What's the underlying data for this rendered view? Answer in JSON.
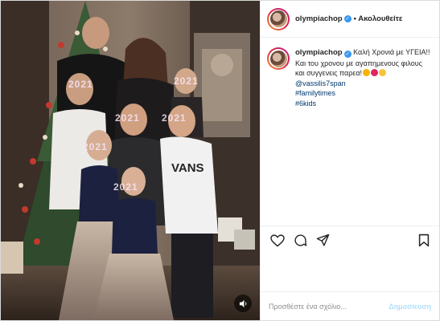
{
  "account": {
    "username": "olympiachop",
    "follow_label": "• Ακολουθείτε"
  },
  "caption": {
    "line1": "Καλή Χρονιά με ΥΓΕΙΑ!!",
    "line2": "Και του χρονου με αγαπημενους φιλους και συγγενεις παρεα!",
    "mention": "@vassilis7span",
    "hashtags": [
      "#familytimes",
      "#6kids"
    ]
  },
  "comment": {
    "placeholder": "Προσθέστε ένα σχόλιο...",
    "publish_label": "Δημοσίευση"
  },
  "media": {
    "overlay_text": [
      "2021",
      "2021",
      "2021",
      "2021",
      "2021",
      "2021"
    ]
  },
  "icons": {
    "verified": "verified-badge-icon",
    "like": "heart-icon",
    "comment": "comment-bubble-icon",
    "share": "paper-plane-icon",
    "save": "bookmark-icon",
    "mute": "speaker-icon"
  },
  "colors": {
    "link": "#00376b",
    "verified": "#3897f0",
    "publish_disabled": "#b2dffc",
    "muted_text": "#8e8e8e"
  }
}
